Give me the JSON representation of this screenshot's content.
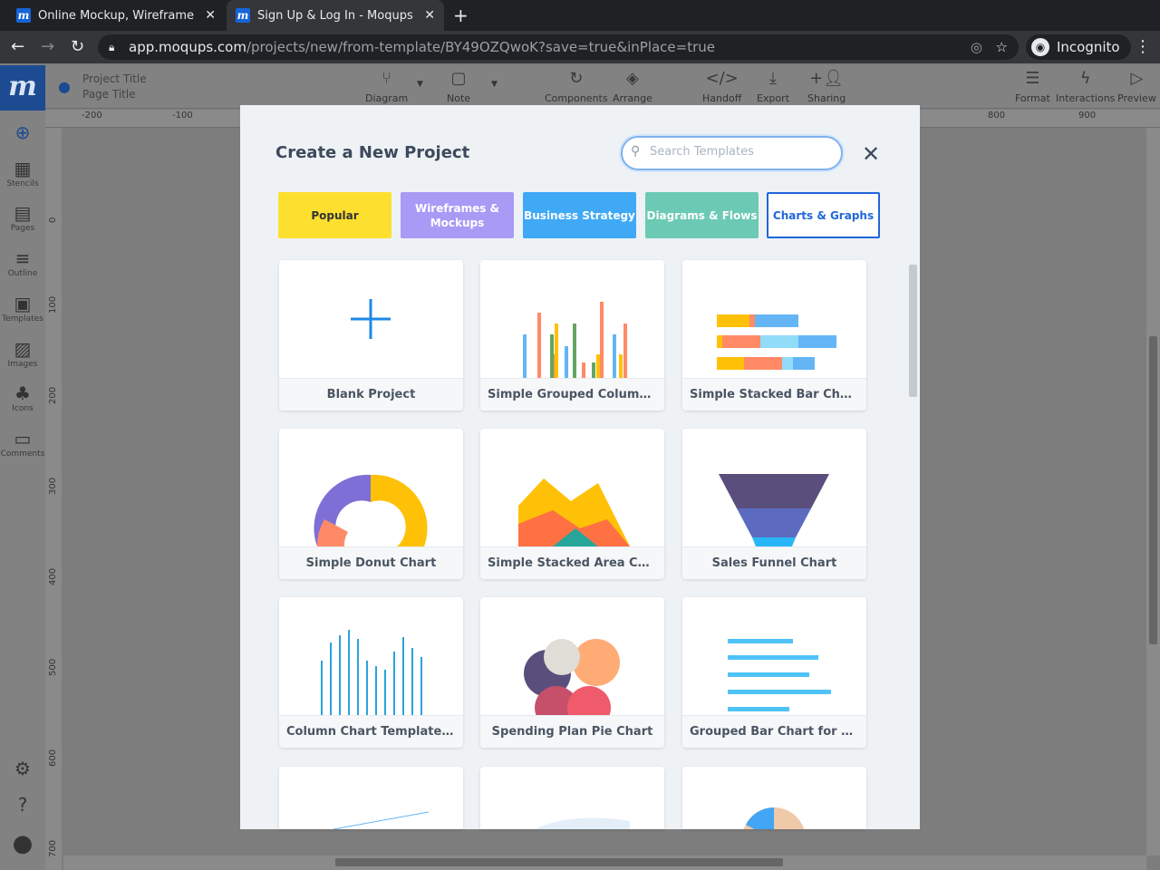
{
  "browser": {
    "tabs": [
      {
        "title": "Online Mockup, Wireframe"
      },
      {
        "title": "Sign Up & Log In - Moqups"
      }
    ],
    "url_host": "app.moqups.com",
    "url_path": "/projects/new/from-template/BY49OZQwoK?save=true&inPlace=true",
    "profile": "Incognito"
  },
  "app": {
    "logo": "m",
    "project_title": "Project Title",
    "page_title": "Page Title",
    "toolbar": [
      "Diagram",
      "Note",
      "Components",
      "Arrange",
      "Handoff",
      "Export",
      "Sharing",
      "Format",
      "Interactions",
      "Preview"
    ],
    "sidebar": [
      "Stencils",
      "Pages",
      "Outline",
      "Templates",
      "Images",
      "Icons",
      "Comments"
    ],
    "ruler_top": [
      "-200",
      "-100",
      "800",
      "900"
    ],
    "ruler_left": [
      "0",
      "100",
      "200",
      "300",
      "400",
      "500",
      "600",
      "700"
    ]
  },
  "modal": {
    "title": "Create a New Project",
    "search_placeholder": "Search Templates",
    "categories": [
      {
        "label": "Popular",
        "color": "#fde02f"
      },
      {
        "label": "Wireframes & Mockups",
        "color": "#a99af5"
      },
      {
        "label": "Business Strategy",
        "color": "#3fa9f5"
      },
      {
        "label": "Diagrams & Flows",
        "color": "#6cc9b4"
      },
      {
        "label": "Charts & Graphs",
        "color": "#ffffff"
      }
    ],
    "templates": [
      "Blank Project",
      "Simple Grouped Column...",
      "Simple Stacked Bar Chart",
      "Simple Donut Chart",
      "Simple Stacked Area Ch...",
      "Sales Funnel Chart",
      "Column Chart Template ...",
      "Spending Plan Pie Chart",
      "Grouped Bar Chart for U..."
    ]
  }
}
